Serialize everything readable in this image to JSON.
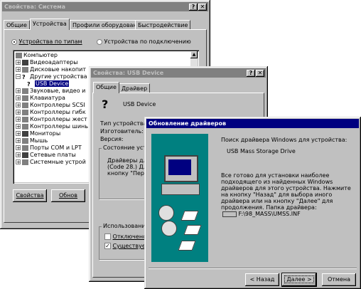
{
  "sys": {
    "title": "Свойства: Система",
    "tabs": [
      "Общие",
      "Устройства",
      "Профили оборудования",
      "Быстродействие"
    ],
    "radio_type": "Устройства по типам",
    "radio_conn": "Устройства по подключению",
    "tree": [
      "Компьютер",
      "Видеоадаптеры",
      "Дисковые накопит",
      "Другие устройства",
      "USB Device",
      "Звуковые, видео и",
      "Клавиатура",
      "Контроллеры SCSI",
      "Контроллеры гибк",
      "Контроллеры жест",
      "Контроллеры шинь",
      "Мониторы",
      "Мышь",
      "Порты COM и LPT",
      "Сетевые платы",
      "Системные устрой"
    ],
    "btn_props": "Свойства",
    "btn_refresh": "Обнов"
  },
  "usb": {
    "title": "Свойства: USB Device",
    "tabs": [
      "Общие",
      "Драйвер"
    ],
    "device_name": "USB Device",
    "lbl_type": "Тип устройства:",
    "lbl_maker": "Изготовитель:",
    "lbl_version": "Версия:",
    "status_group": "Состояние устро",
    "status_line1": "Драйверы для",
    "status_line2": "(Code 28.) Для",
    "status_line3": "кнопку \"Переу",
    "usage_group": "Использование",
    "chk_disabled": "Отключено",
    "chk_exists": "Существует"
  },
  "upd": {
    "title": "Обновление драйверов",
    "search_text": "Поиск драйвера Windows для устройства:",
    "device": "USB Mass Storage Drive",
    "info_text": "Все готово для установки наиболее подходящего из найденных Windows драйверов для этого устройства. Нажмите на кнопку \"Назад\" для выбора иного драйвера или на кнопку \"Далее\" для продолжения. Папка драйвера:",
    "path": "F:\\98_MASS\\UMSS.INF",
    "btn_back": "< Назад",
    "btn_next": "Далее >",
    "btn_cancel": "Отмена"
  },
  "colors": {
    "active_title": "#000080",
    "inactive_title": "#808080",
    "face": "#c0c0c0"
  }
}
